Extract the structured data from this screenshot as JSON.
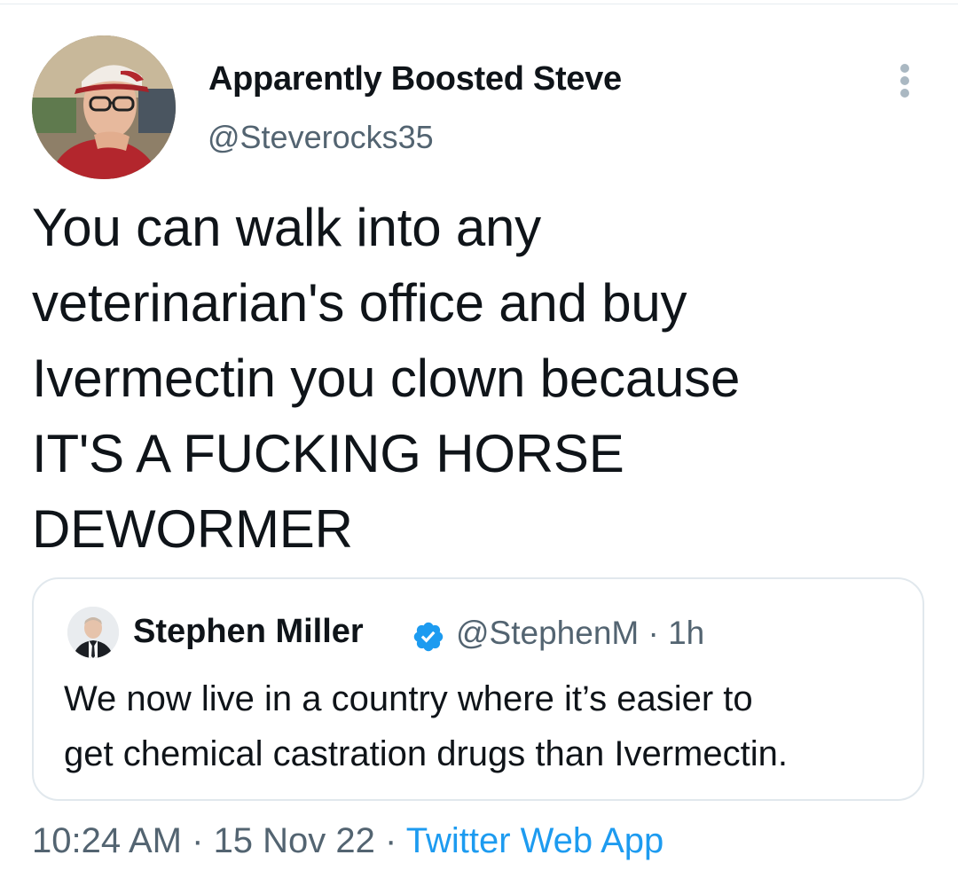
{
  "tweet": {
    "author": {
      "name": "Apparently Boosted Steve",
      "handle": "@Steverocks35",
      "avatar": "profile-photo-man-cap-glasses"
    },
    "text": "You can walk into any\nveterinarian's office and buy\nIvermectin you clown because\nIT'S A FUCKING HORSE\nDEWORMER",
    "time": "10:24 AM",
    "separator": " · ",
    "date": "15 Nov 22",
    "source": "Twitter Web App",
    "more_icon": "more-vertical-icon"
  },
  "quoted_tweet": {
    "author": {
      "name": "Stephen Miller",
      "handle_time": "@StephenM · 1h",
      "verified_icon": "verified-badge-icon",
      "avatar": "profile-photo-man-suit"
    },
    "text": "We now live in a country where it’s easier to\nget chemical castration drugs than Ivermectin."
  },
  "colors": {
    "text_primary": "#0f1419",
    "text_secondary": "#536471",
    "link": "#1d9bf0",
    "border": "#e1e8ed",
    "verified": "#1d9bf0"
  }
}
